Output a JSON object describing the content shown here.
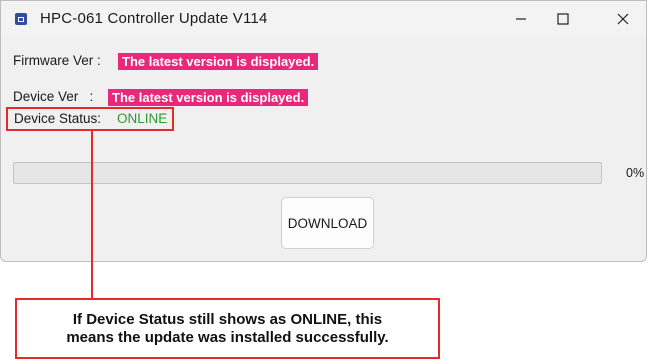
{
  "window": {
    "title": "HPC-061 Controller Update V114",
    "controls": {
      "minimize": "minimize",
      "maximize": "maximize",
      "close": "close"
    }
  },
  "firmware": {
    "label": "Firmware Ver :",
    "value": "The latest version is displayed."
  },
  "device_ver": {
    "label": "Device Ver   :",
    "value": "The latest version is displayed."
  },
  "device_status": {
    "label": "Device Status:",
    "value": "ONLINE",
    "value_color": "#2c9a2c"
  },
  "progress": {
    "percent": 0,
    "text": "0%"
  },
  "download_button": {
    "label": "DOWNLOAD"
  },
  "note": {
    "line1": "If Device Status still shows as ONLINE, this",
    "line2": "means the update was installed successfully."
  },
  "colors": {
    "highlight": "#e8287a",
    "callout": "#e42a2a"
  },
  "icons": {
    "app": "app-icon",
    "minimize": "minimize-icon",
    "maximize": "maximize-icon",
    "close": "close-icon"
  }
}
